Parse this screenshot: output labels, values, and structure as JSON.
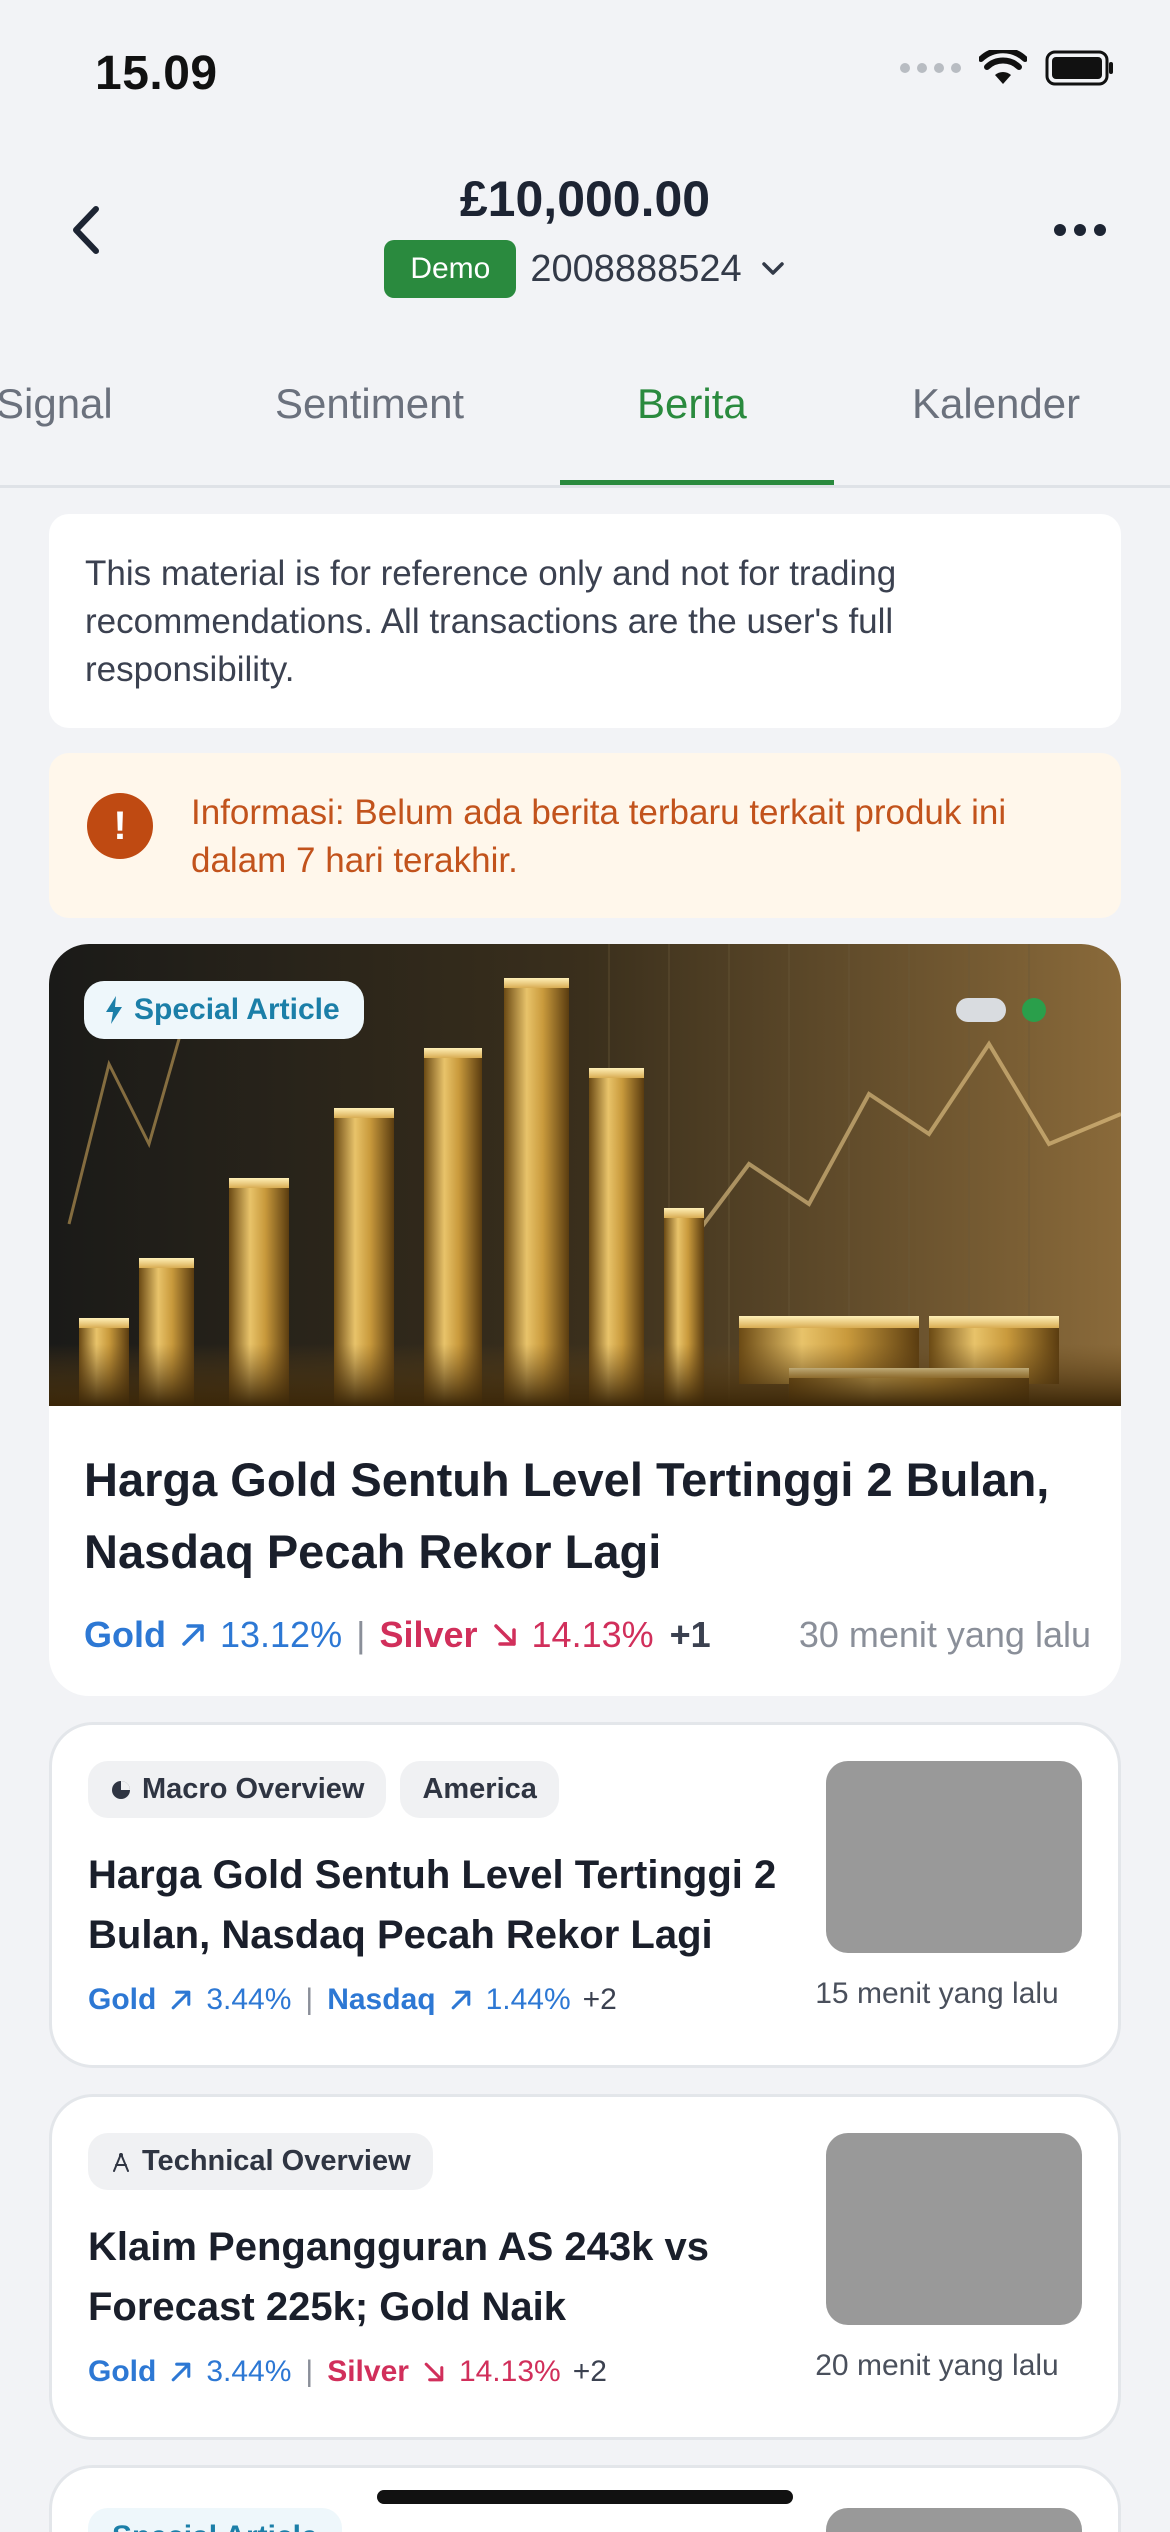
{
  "status_bar": {
    "time": "15.09"
  },
  "header": {
    "balance": "£10,000.00",
    "account_badge": "Demo",
    "account_number": "2008888524"
  },
  "tabs": [
    {
      "label": "Signal",
      "active": false
    },
    {
      "label": "Sentiment",
      "active": false
    },
    {
      "label": "Berita",
      "active": true
    },
    {
      "label": "Kalender",
      "active": false
    }
  ],
  "disclaimer": "This material is for reference only and not for trading recommendations. All transactions are the user's full responsibility.",
  "notice": {
    "icon": "!",
    "text": "Informasi: Belum ada berita terbaru terkait produk ini dalam 7 hari terakhir."
  },
  "featured": {
    "badge": "Special Article",
    "title": "Harga Gold Sentuh Level Tertinggi 2 Bulan, Nasdaq Pecah Rekor Lagi",
    "tickers": [
      {
        "name": "Gold",
        "change": "13.12%",
        "direction": "up"
      },
      {
        "name": "Silver",
        "change": "14.13%",
        "direction": "down"
      }
    ],
    "more": "+1",
    "time": "30 menit yang lalu",
    "carousel": {
      "count": 2,
      "active_index": 1
    }
  },
  "articles": [
    {
      "tags": [
        {
          "label": "Macro Overview",
          "icon": "pie-chart-icon"
        },
        {
          "label": "America",
          "icon": ""
        }
      ],
      "title": "Harga Gold Sentuh Level Tertinggi 2 Bulan, Nasdaq Pecah Rekor Lagi",
      "tickers": [
        {
          "name": "Gold",
          "change": "3.44%",
          "direction": "up"
        },
        {
          "name": "Nasdaq",
          "change": "1.44%",
          "direction": "up"
        }
      ],
      "more": "+2",
      "time": "15 menit yang lalu"
    },
    {
      "tags": [
        {
          "label": "Technical Overview",
          "icon": "compass-icon"
        }
      ],
      "title": "Klaim Pengangguran AS 243k vs Forecast 225k; Gold Naik",
      "tickers": [
        {
          "name": "Gold",
          "change": "3.44%",
          "direction": "up"
        },
        {
          "name": "Silver",
          "change": "14.13%",
          "direction": "down"
        }
      ],
      "more": "+2",
      "time": "20 menit yang lalu"
    }
  ],
  "next_card_badge": "Special Article",
  "colors": {
    "accent_green": "#2a8a3e",
    "up_blue": "#2d78d4",
    "down_red": "#d12f5b",
    "notice_orange": "#c2531c"
  }
}
